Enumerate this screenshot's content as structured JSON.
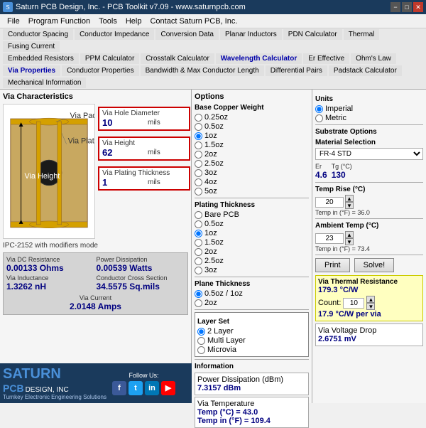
{
  "titleBar": {
    "title": "Saturn PCB Design, Inc. - PCB Toolkit v7.09 - www.saturnpcb.com",
    "icon": "S"
  },
  "menuBar": {
    "items": [
      "File",
      "Program Function",
      "Tools",
      "Help",
      "Contact Saturn PCB, Inc."
    ]
  },
  "toolbar": {
    "row1": [
      "Conductor Spacing",
      "Conductor Impedance",
      "Conversion Data",
      "Planar Inductors",
      "PDN Calculator",
      "Thermal",
      "Fusing Current"
    ],
    "row2": [
      "Embedded Resistors",
      "PPM Calculator",
      "Crosstalk Calculator",
      "Wavelength Calculator",
      "Er Effective",
      "Ohm's Law",
      ""
    ],
    "row3": [
      "Via Properties",
      "Conductor Properties",
      "Bandwidth & Max Conductor Length",
      "Differential Pairs",
      "Padstack Calculator",
      "Mechanical Information"
    ]
  },
  "leftPanel": {
    "title": "Via Characteristics",
    "inputs": {
      "holeDiameter": {
        "label": "Via Hole Diameter",
        "value": "10",
        "unit": "mils"
      },
      "height": {
        "label": "Via Height",
        "value": "62",
        "unit": "mils"
      },
      "platingThickness": {
        "label": "Via Plating Thickness",
        "value": "1",
        "unit": "mils"
      }
    },
    "ipcLabel": "IPC-2152 with modifiers mode",
    "results": {
      "dcResistance": {
        "label": "Via DC Resistance",
        "value": "0.00133 Ohms"
      },
      "powerDissipation": {
        "label": "Power Dissipation",
        "value": "0.00539 Watts"
      },
      "inductance": {
        "label": "Via Inductance",
        "value": "1.3262 nH"
      },
      "crossSection": {
        "label": "Conductor Cross Section",
        "value": "34.5575 Sq.mils"
      },
      "current": {
        "label": "Via Current",
        "value": "2.0148 Amps"
      }
    },
    "logo": {
      "saturn": "SATURN",
      "pcb": "PCB",
      "designInc": "DESIGN, INC",
      "tagline": "Turnkey Electronic Engineering Solutions",
      "followUs": "Follow Us:"
    }
  },
  "optionsPanel": {
    "title": "Options",
    "baseCopper": {
      "label": "Base Copper Weight",
      "options": [
        "0.25oz",
        "0.5oz",
        "1oz",
        "1.5oz",
        "2oz",
        "2.5oz",
        "3oz",
        "4oz",
        "5oz"
      ],
      "selected": "1oz"
    },
    "platingThickness": {
      "label": "Plating Thickness",
      "options": [
        "Bare PCB",
        "0.5oz",
        "1oz",
        "1.5oz",
        "2oz",
        "2.5oz",
        "3oz"
      ],
      "selected": "1oz"
    },
    "planeThickness": {
      "label": "Plane Thickness",
      "options": [
        "0.5oz / 1oz",
        "2oz"
      ],
      "selected": "0.5oz / 1oz"
    },
    "layerSet": {
      "label": "Layer Set",
      "options": [
        "2 Layer",
        "Multi Layer",
        "Microvia"
      ],
      "selected": "2 Layer"
    },
    "information": {
      "label": "Information",
      "powerDissipation": {
        "label": "Power Dissipation (dBm)",
        "value": "7.3157 dBm"
      },
      "viaTemperature": {
        "label": "Via Temperature",
        "valueLine1": "Temp (°C) = 43.0",
        "valueLine2": "Temp in (°F) = 109.4"
      }
    }
  },
  "rightPanel": {
    "units": {
      "label": "Units",
      "options": [
        "Imperial",
        "Metric"
      ],
      "selected": "Imperial"
    },
    "substrate": {
      "label": "Substrate Options",
      "materialLabel": "Material Selection",
      "material": "FR-4 STD",
      "erLabel": "Er",
      "erValue": "4.6",
      "tgLabel": "Tg (°C)",
      "tgValue": "130"
    },
    "tempRise": {
      "label": "Temp Rise (°C)",
      "value": "20",
      "tempF": "Temp in (°F) = 36.0"
    },
    "ambientTemp": {
      "label": "Ambient Temp (°C)",
      "value": "23",
      "tempF": "Temp in (°F) = 73.4"
    },
    "buttons": {
      "print": "Print",
      "solve": "Solve!"
    },
    "thermalResistance": {
      "label": "Via Thermal Resistance",
      "value": "179.3 °C/W",
      "countLabel": "Count:",
      "countValue": "10",
      "perVia": "17.9 °C/W per via"
    },
    "voltageDropLabel": "Via Voltage Drop",
    "voltageDropValue": "2.6751 mV"
  }
}
